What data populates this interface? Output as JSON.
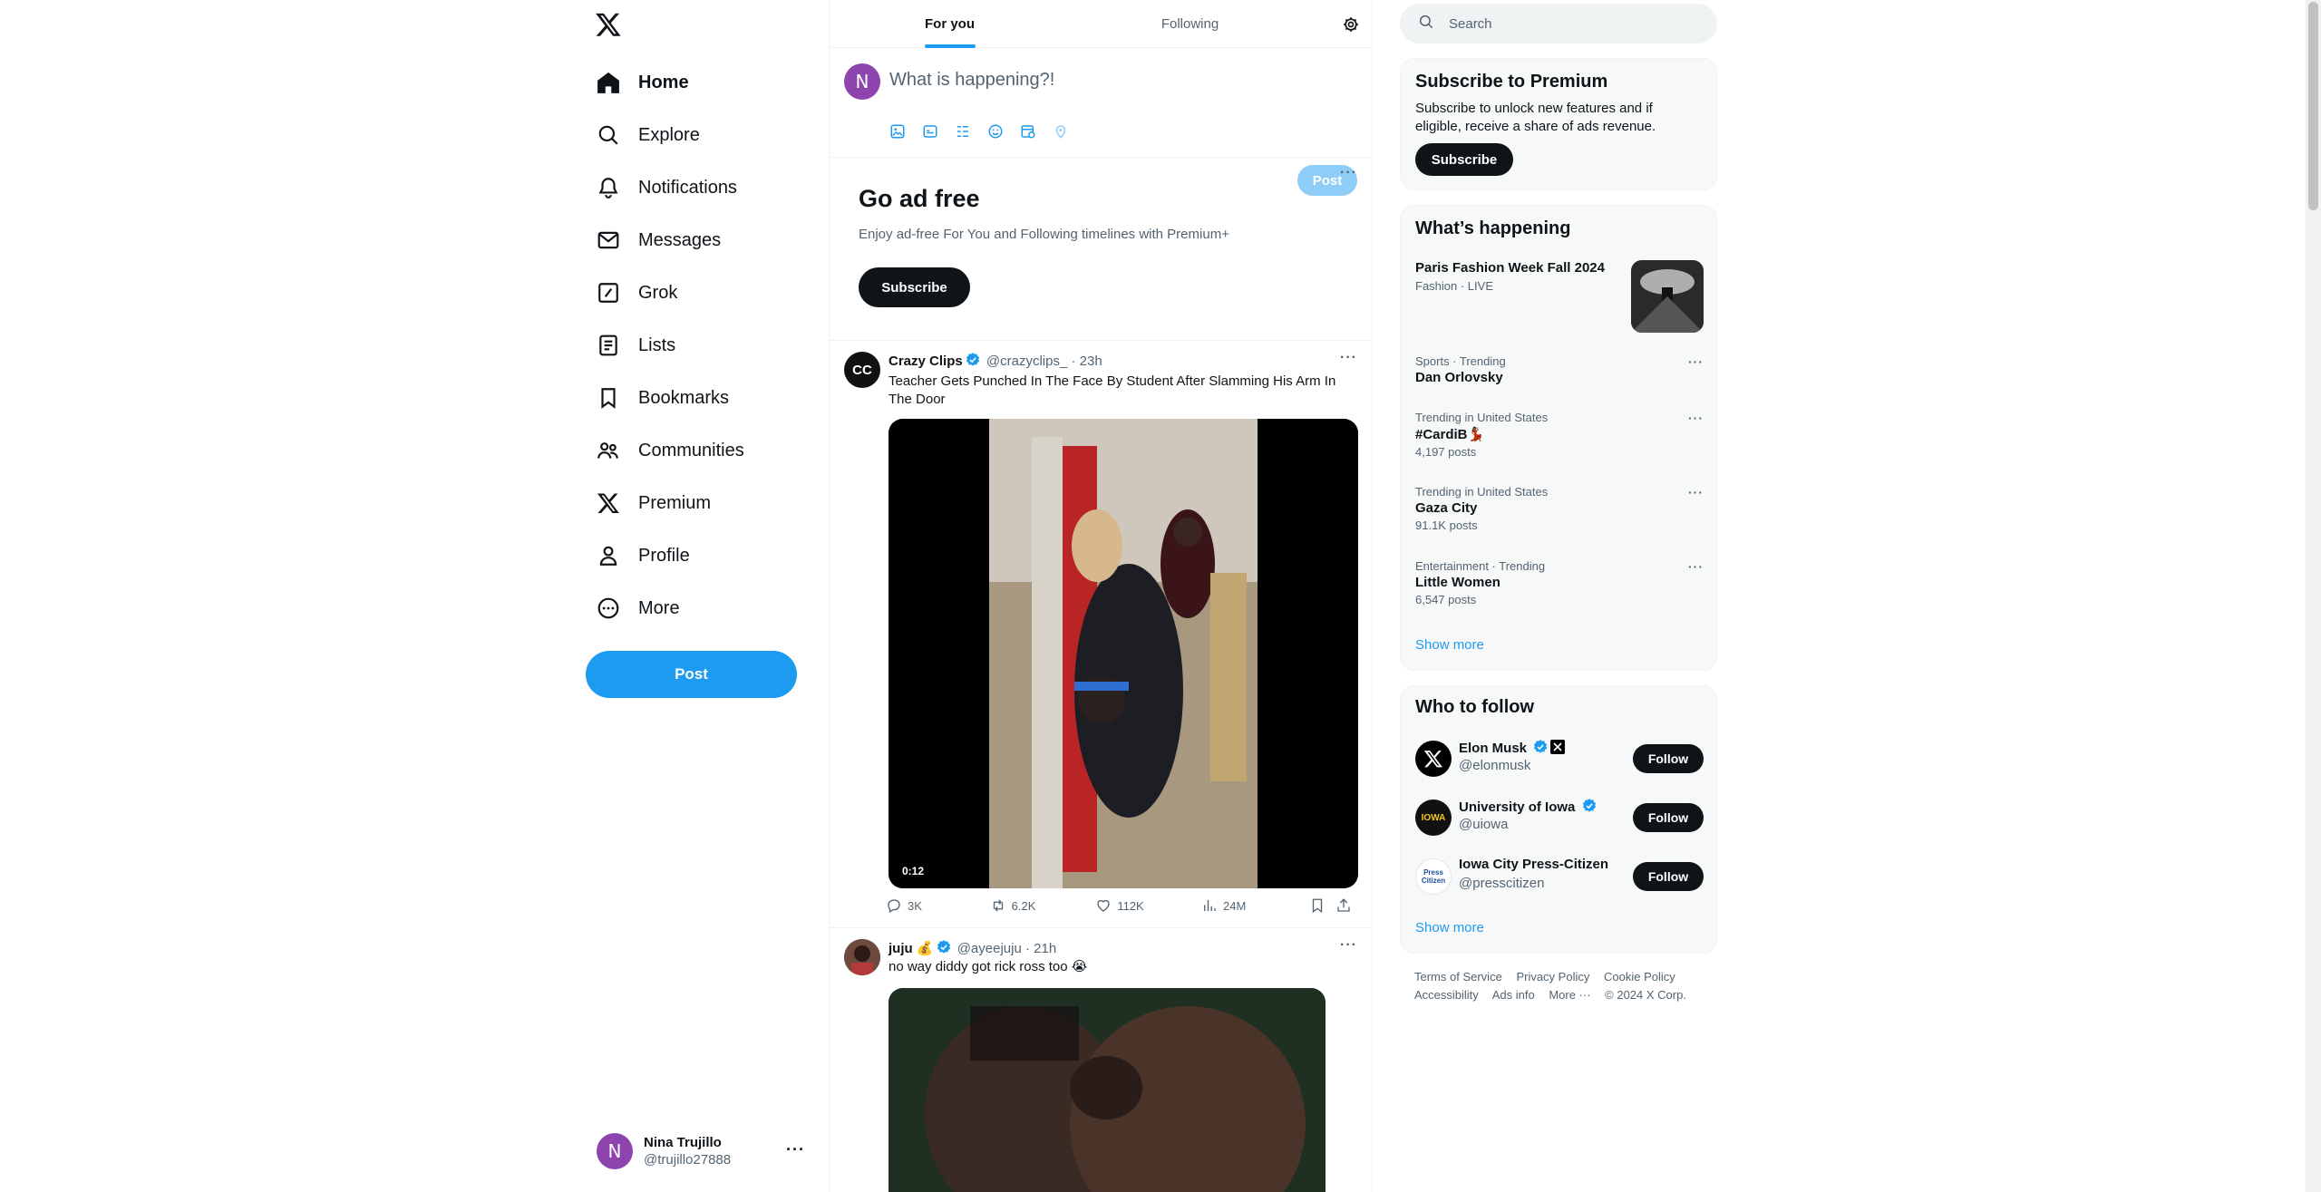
{
  "sidebar": {
    "items": [
      {
        "label": "Home",
        "icon": "home-icon"
      },
      {
        "label": "Explore",
        "icon": "search-icon"
      },
      {
        "label": "Notifications",
        "icon": "bell-icon"
      },
      {
        "label": "Messages",
        "icon": "mail-icon"
      },
      {
        "label": "Grok",
        "icon": "grok-icon"
      },
      {
        "label": "Lists",
        "icon": "list-icon"
      },
      {
        "label": "Bookmarks",
        "icon": "bookmark-icon"
      },
      {
        "label": "Communities",
        "icon": "people-icon"
      },
      {
        "label": "Premium",
        "icon": "x-logo-icon"
      },
      {
        "label": "Profile",
        "icon": "person-icon"
      },
      {
        "label": "More",
        "icon": "more-circle-icon"
      }
    ],
    "post_label": "Post",
    "account": {
      "initial": "N",
      "name": "Nina Trujillo",
      "handle": "@trujillo27888",
      "more": "···"
    }
  },
  "main": {
    "tabs": [
      {
        "label": "For you"
      },
      {
        "label": "Following"
      }
    ],
    "composer": {
      "initial": "N",
      "placeholder": "What is happening?!",
      "post_label": "Post"
    },
    "adfree": {
      "title": "Go ad free",
      "text": "Enjoy ad-free For You and Following timelines with Premium+",
      "button": "Subscribe",
      "more": "···"
    },
    "tweets": [
      {
        "name": "Crazy Clips",
        "handle": "@crazyclips_",
        "time": "· 23h",
        "text": "Teacher Gets Punched In The Face By Student After Slamming His Arm In The Door",
        "video_duration": "0:12",
        "replies": "3K",
        "reposts": "6.2K",
        "likes": "112K",
        "views": "24M",
        "more": "···"
      },
      {
        "name": "juju 💰",
        "handle": "@ayeejuju",
        "time": "· 21h",
        "text": "no way diddy got rick ross too 😭",
        "more": "···"
      }
    ]
  },
  "right": {
    "search_placeholder": "Search",
    "premium": {
      "title": "Subscribe to Premium",
      "text": "Subscribe to unlock new features and if eligible, receive a share of ads revenue.",
      "button": "Subscribe"
    },
    "happening": {
      "title": "What’s happening",
      "featured": {
        "title": "Paris Fashion Week Fall 2024",
        "meta": "Fashion · LIVE"
      },
      "trends": [
        {
          "meta": "Sports · Trending",
          "title": "Dan Orlovsky",
          "count": ""
        },
        {
          "meta": "Trending in United States",
          "title": "#CardiB💃🏾",
          "count": "4,197 posts"
        },
        {
          "meta": "Trending in United States",
          "title": "Gaza City",
          "count": "91.1K posts"
        },
        {
          "meta": "Entertainment · Trending",
          "title": "Little Women",
          "count": "6,547 posts"
        }
      ],
      "show_more": "Show more"
    },
    "follow": {
      "title": "Who to follow",
      "users": [
        {
          "name": "Elon Musk",
          "handle": "@elonmusk",
          "button": "Follow"
        },
        {
          "name": "University of Iowa",
          "handle": "@uiowa",
          "button": "Follow",
          "avatar_text": "IOWA"
        },
        {
          "name": "Iowa City Press-Citizen",
          "handle": "@presscitizen",
          "button": "Follow",
          "avatar_text": "Press Citizen"
        }
      ],
      "show_more": "Show more"
    },
    "footer": {
      "links": [
        "Terms of Service",
        "Privacy Policy",
        "Cookie Policy",
        "Accessibility",
        "Ads info",
        "More ···"
      ],
      "copyright": "© 2024 X Corp."
    }
  },
  "colors": {
    "accent": "#1d9bf0",
    "text": "#0f1419",
    "muted": "#536471",
    "avatar": "#8e44ad"
  }
}
